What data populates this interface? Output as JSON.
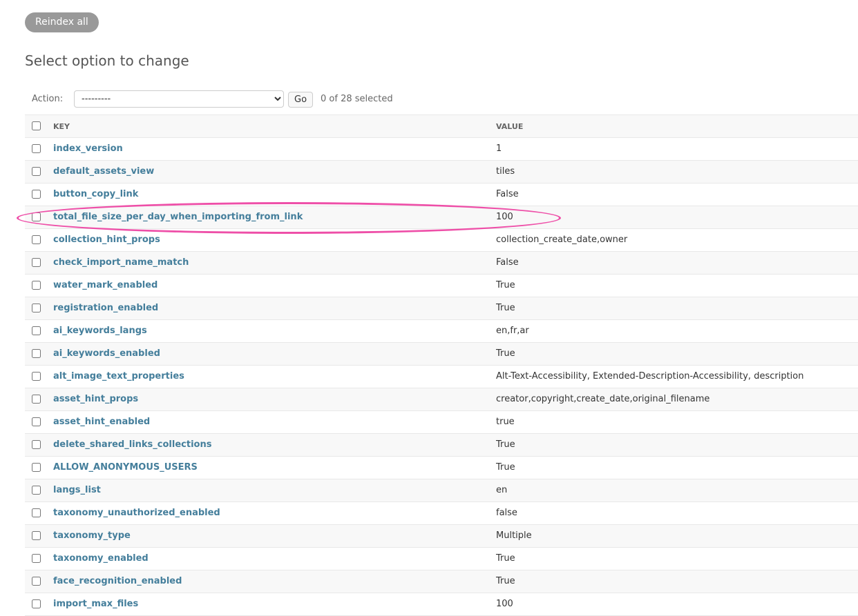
{
  "toolbar": {
    "reindex_label": "Reindex all"
  },
  "page": {
    "title": "Select option to change"
  },
  "actions": {
    "label": "Action:",
    "selected_option": "---------",
    "go_label": "Go",
    "counter": "0 of 28 selected"
  },
  "table": {
    "headers": {
      "key": "KEY",
      "value": "VALUE"
    },
    "rows": [
      {
        "key": "index_version",
        "value": "1"
      },
      {
        "key": "default_assets_view",
        "value": "tiles"
      },
      {
        "key": "button_copy_link",
        "value": "False"
      },
      {
        "key": "total_file_size_per_day_when_importing_from_link",
        "value": "100"
      },
      {
        "key": "collection_hint_props",
        "value": "collection_create_date,owner"
      },
      {
        "key": "check_import_name_match",
        "value": "False"
      },
      {
        "key": "water_mark_enabled",
        "value": "True"
      },
      {
        "key": "registration_enabled",
        "value": "True"
      },
      {
        "key": "ai_keywords_langs",
        "value": "en,fr,ar"
      },
      {
        "key": "ai_keywords_enabled",
        "value": "True"
      },
      {
        "key": "alt_image_text_properties",
        "value": "Alt-Text-Accessibility, Extended-Description-Accessibility, description"
      },
      {
        "key": "asset_hint_props",
        "value": "creator,copyright,create_date,original_filename"
      },
      {
        "key": "asset_hint_enabled",
        "value": "true"
      },
      {
        "key": "delete_shared_links_collections",
        "value": "True"
      },
      {
        "key": "ALLOW_ANONYMOUS_USERS",
        "value": "True"
      },
      {
        "key": "langs_list",
        "value": "en"
      },
      {
        "key": "taxonomy_unauthorized_enabled",
        "value": "false"
      },
      {
        "key": "taxonomy_type",
        "value": "Multiple"
      },
      {
        "key": "taxonomy_enabled",
        "value": "True"
      },
      {
        "key": "face_recognition_enabled",
        "value": "True"
      },
      {
        "key": "import_max_files",
        "value": "100"
      }
    ]
  },
  "colors": {
    "highlight": "#ee4fa8",
    "link": "#447e9b",
    "button": "#999999"
  }
}
